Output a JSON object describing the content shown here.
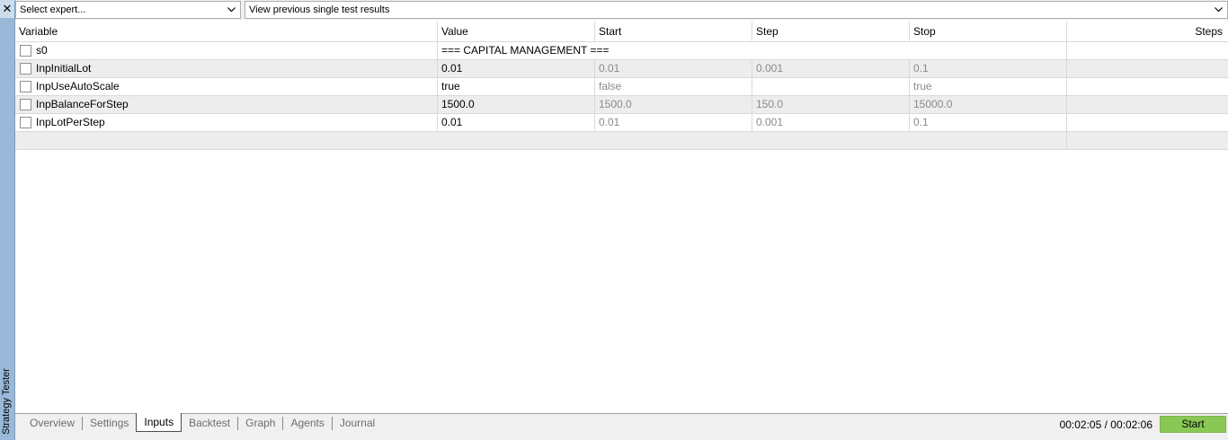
{
  "sidebar": {
    "title": "Strategy Tester",
    "close_icon": "close-icon"
  },
  "toolbar": {
    "expert_select": "Select expert...",
    "results_select": "View previous single test results"
  },
  "grid": {
    "columns": [
      "Variable",
      "Value",
      "Start",
      "Step",
      "Stop",
      "Steps"
    ],
    "section_row": {
      "name": "s0",
      "value": "=== CAPITAL MANAGEMENT ==="
    },
    "rows": [
      {
        "name": "InpInitialLot",
        "value": "0.01",
        "start": "0.01",
        "step": "0.001",
        "stop": "0.1",
        "steps": ""
      },
      {
        "name": "InpUseAutoScale",
        "value": "true",
        "start": "false",
        "step": "",
        "stop": "true",
        "steps": ""
      },
      {
        "name": "InpBalanceForStep",
        "value": "1500.0",
        "start": "1500.0",
        "step": "150.0",
        "stop": "15000.0",
        "steps": ""
      },
      {
        "name": "InpLotPerStep",
        "value": "0.01",
        "start": "0.01",
        "step": "0.001",
        "stop": "0.1",
        "steps": ""
      }
    ]
  },
  "tabs": [
    "Overview",
    "Settings",
    "Inputs",
    "Backtest",
    "Graph",
    "Agents",
    "Journal"
  ],
  "active_tab": "Inputs",
  "status": {
    "timer": "00:02:05 / 00:02:06",
    "start_label": "Start"
  },
  "colors": {
    "sidebar": "#9ab9d8",
    "start_button": "#8ac856",
    "alt_row": "#ededed"
  }
}
